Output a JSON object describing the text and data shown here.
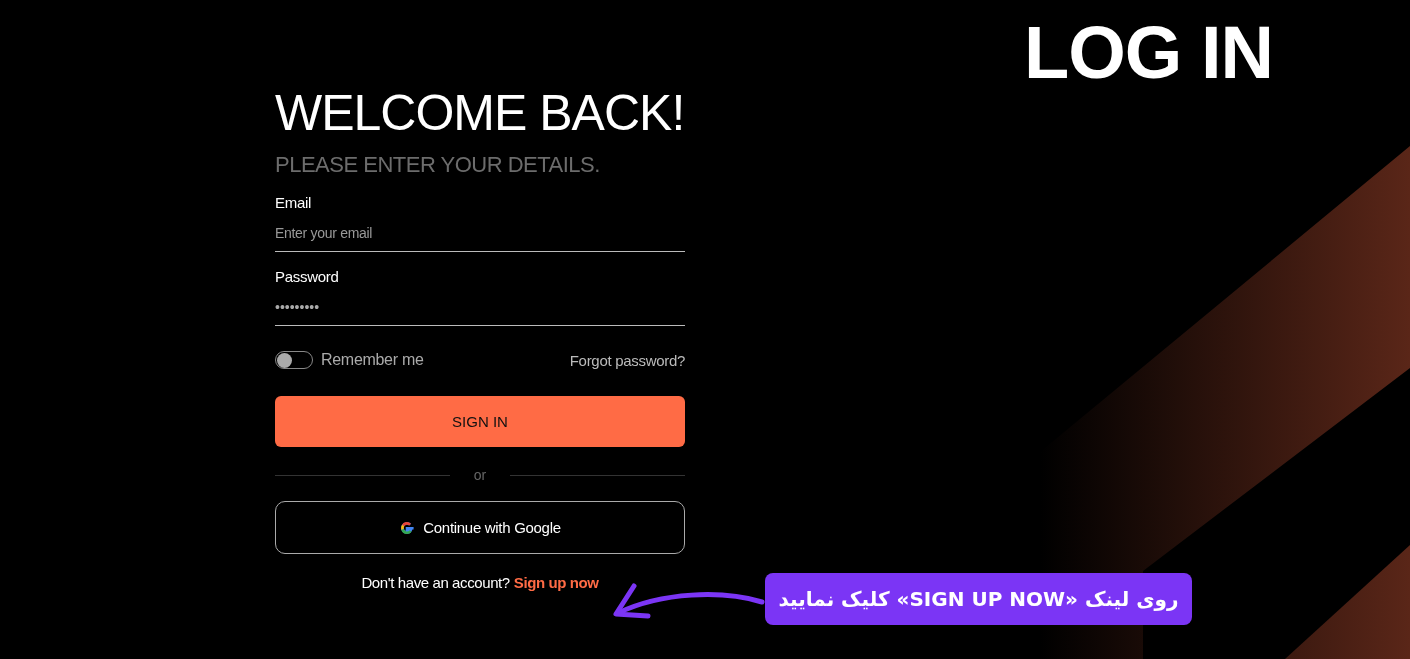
{
  "heading": "LOG IN",
  "form": {
    "title": "WELCOME BACK!",
    "subtitle": "PLEASE ENTER YOUR DETAILS.",
    "fields": [
      {
        "label": "Email",
        "placeholder": "Enter your email",
        "kind": "text"
      },
      {
        "label": "Password",
        "value": "•••••••••",
        "kind": "password"
      }
    ],
    "remember": {
      "label": "Remember me",
      "on": false
    },
    "forgot": "Forgot password?",
    "submit": "SIGN IN",
    "divider": "or",
    "google": "Continue with Google",
    "signup_prompt": "Don't have an account?",
    "signup_link": "Sign up now"
  },
  "callout": {
    "text": "روی لینک «SIGN UP NOW» کلیک نمایید"
  }
}
